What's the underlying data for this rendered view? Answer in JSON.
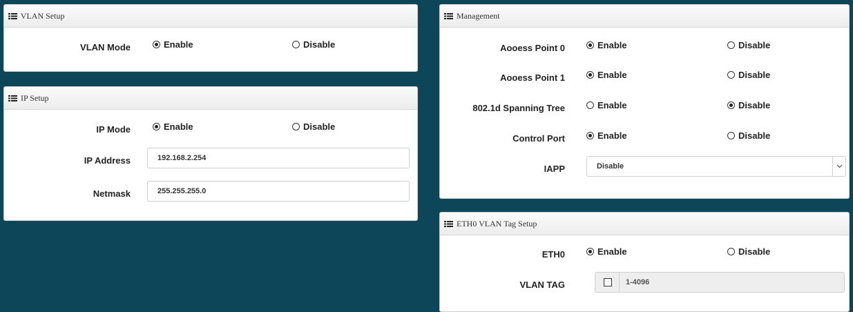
{
  "vlan_setup": {
    "title": "VLAN Setup",
    "mode_label": "VLAN Mode",
    "enable_label": "Enable",
    "disable_label": "Disable",
    "selected": "Enable"
  },
  "ip_setup": {
    "title": "IP Setup",
    "mode_label": "IP Mode",
    "enable_label": "Enable",
    "disable_label": "Disable",
    "selected": "Enable",
    "address_label": "IP Address",
    "address_value": "192.168.2.254",
    "netmask_label": "Netmask",
    "netmask_value": "255.255.255.0"
  },
  "management": {
    "title": "Management",
    "enable_label": "Enable",
    "disable_label": "Disable",
    "rows": [
      {
        "label": "Aooess Point 0",
        "selected": "Enable"
      },
      {
        "label": "Aooess Point 1",
        "selected": "Enable"
      },
      {
        "label": "802.1d Spanning Tree",
        "selected": "Disable"
      },
      {
        "label": "Control Port",
        "selected": "Enable"
      }
    ],
    "iapp_label": "IAPP",
    "iapp_value": "Disable"
  },
  "eth0_vlan_tag": {
    "title": "ETH0 VLAN Tag Setup",
    "eth0_label": "ETH0",
    "enable_label": "Enable",
    "disable_label": "Disable",
    "selected": "Enable",
    "vlan_tag_label": "VLAN TAG",
    "vlan_tag_placeholder": "1-4096",
    "vlan_tag_checked": false
  },
  "colors": {
    "background": "#0d4659",
    "panel": "#ffffff",
    "header": "#ececec"
  },
  "icons": {
    "header_icon": "list-icon",
    "select_arrow": "chevron-down-icon"
  }
}
